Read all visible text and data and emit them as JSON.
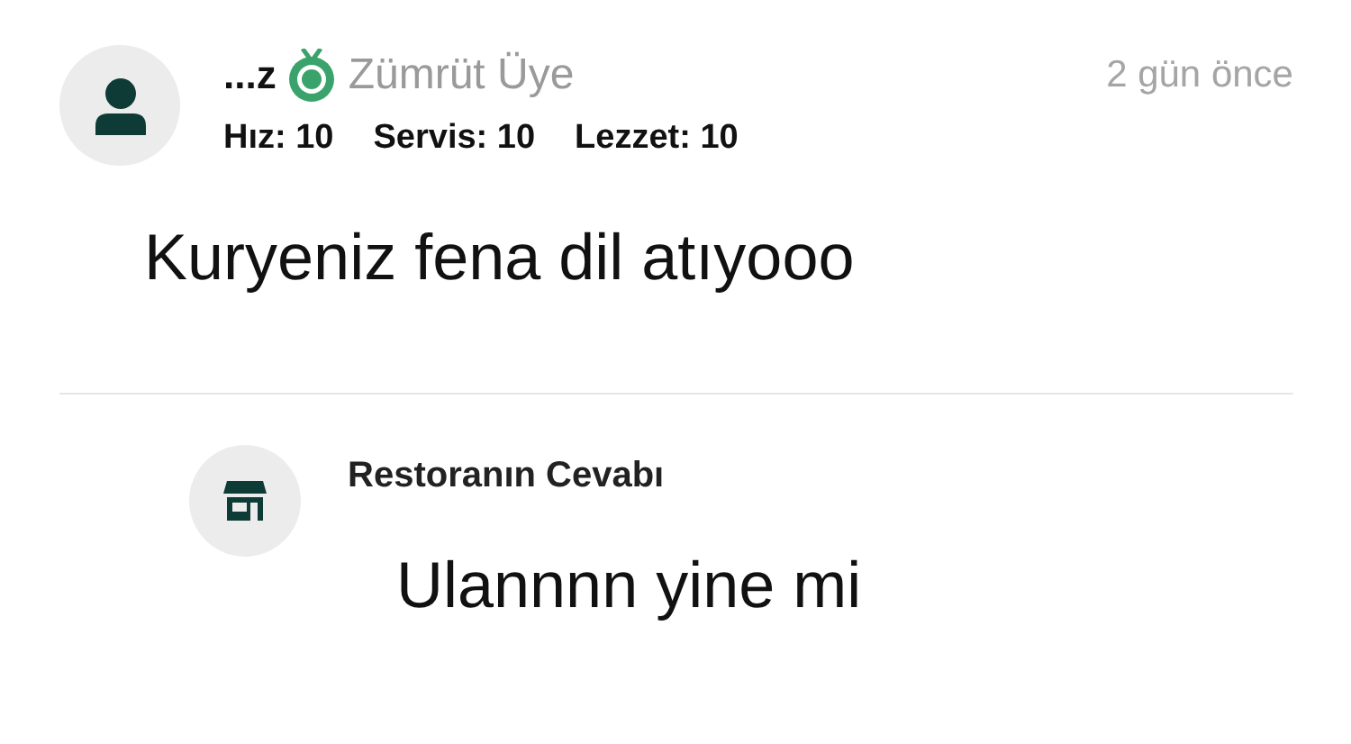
{
  "review": {
    "author": "...z",
    "membership": "Zümrüt Üye",
    "time": "2 gün önce",
    "ratings": [
      "Hız: 10",
      "Servis: 10",
      "Lezzet: 10"
    ],
    "comment": "Kuryeniz fena dil atıyooo"
  },
  "reply": {
    "title": "Restoranın Cevabı",
    "text": "Ulannnn yine mi"
  }
}
